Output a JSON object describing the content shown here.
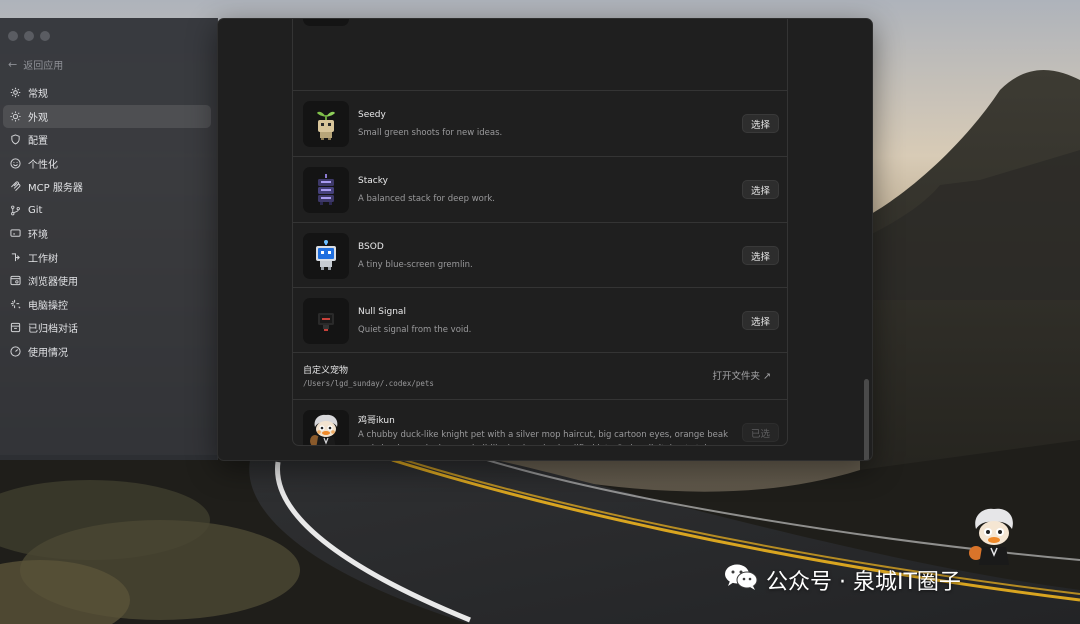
{
  "sidebar": {
    "back_label": "返回应用",
    "items": [
      {
        "label": "常规",
        "icon": "gear-icon"
      },
      {
        "label": "外观",
        "icon": "sun-icon",
        "active": true
      },
      {
        "label": "配置",
        "icon": "shield-icon"
      },
      {
        "label": "个性化",
        "icon": "smile-icon"
      },
      {
        "label": "MCP 服务器",
        "icon": "mcp-icon"
      },
      {
        "label": "Git",
        "icon": "git-branch-icon"
      },
      {
        "label": "环境",
        "icon": "monitor-icon"
      },
      {
        "label": "工作树",
        "icon": "worktree-icon"
      },
      {
        "label": "浏览器使用",
        "icon": "browser-icon"
      },
      {
        "label": "电脑操控",
        "icon": "sparkle-icon"
      },
      {
        "label": "已归档对话",
        "icon": "archive-icon"
      },
      {
        "label": "使用情况",
        "icon": "gauge-icon"
      }
    ]
  },
  "pets": [
    {
      "name": "Seedy",
      "desc": "Small green shoots for new ideas.",
      "button": "选择",
      "avatar_icon": "seedy-pet-icon"
    },
    {
      "name": "Stacky",
      "desc": "A balanced stack for deep work.",
      "button": "选择",
      "avatar_icon": "stacky-pet-icon"
    },
    {
      "name": "BSOD",
      "desc": "A tiny blue-screen gremlin.",
      "button": "选择",
      "avatar_icon": "bsod-pet-icon"
    },
    {
      "name": "Null Signal",
      "desc": "Quiet signal from the void.",
      "button": "选择",
      "avatar_icon": "null-signal-pet-icon"
    }
  ],
  "custom_pets": {
    "label": "自定义宠物",
    "path": "/Users/lgd_sunday/.codex/pets",
    "open_folder": "打开文件夹 ↗"
  },
  "custom_pet": {
    "name": "鸡哥ikun",
    "desc": "A chubby duck-like knight pet with a silver mop haircut, big cartoon eyes, orange beak and cheeks, and a brown shell-like backpack, simplified into Codex digital pet style.",
    "button": "已选",
    "avatar_icon": "ikun-pet-icon"
  },
  "watermark": {
    "text": "公众号 · 泉城IT圈子",
    "icon": "wechat-icon"
  },
  "colors": {
    "window_bg": "#1f1f1f",
    "sidebar_bg": "#2e3036",
    "active_item_bg": "#3a3c42",
    "text_primary": "#e9e9ea",
    "text_secondary": "#9a9a9c"
  }
}
